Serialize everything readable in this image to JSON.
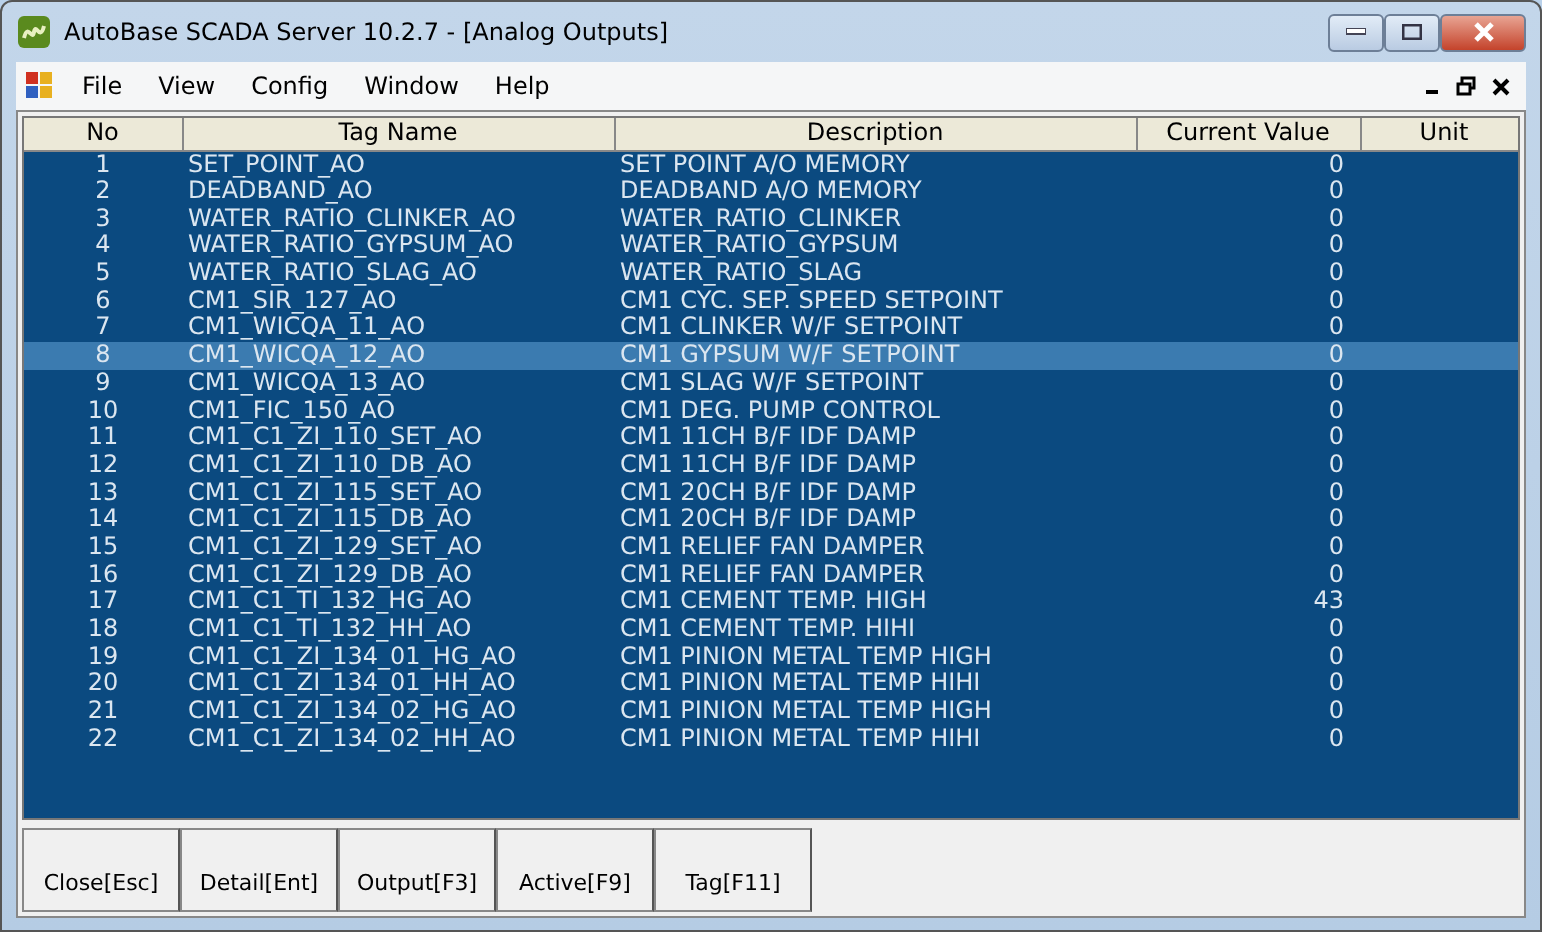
{
  "window": {
    "title": "AutoBase SCADA Server 10.2.7 - [Analog Outputs]"
  },
  "menu": [
    "File",
    "View",
    "Config",
    "Window",
    "Help"
  ],
  "table": {
    "columns": [
      "No",
      "Tag Name",
      "Description",
      "Current Value",
      "Unit"
    ],
    "rows": [
      {
        "cells": [
          "1",
          "SET_POINT_AO",
          "SET POINT A/O MEMORY",
          "0"
        ],
        "selected": false
      },
      {
        "cells": [
          "2",
          "DEADBAND_AO",
          "DEADBAND A/O MEMORY",
          "0"
        ],
        "selected": false
      },
      {
        "cells": [
          "3",
          "WATER_RATIO_CLINKER_AO",
          "WATER_RATIO_CLINKER",
          "0"
        ],
        "selected": false
      },
      {
        "cells": [
          "4",
          "WATER_RATIO_GYPSUM_AO",
          "WATER_RATIO_GYPSUM",
          "0"
        ],
        "selected": false
      },
      {
        "cells": [
          "5",
          "WATER_RATIO_SLAG_AO",
          "WATER_RATIO_SLAG",
          "0"
        ],
        "selected": false
      },
      {
        "cells": [
          "6",
          "CM1_SIR_127_AO",
          "CM1 CYC. SEP. SPEED SETPOINT",
          "0"
        ],
        "selected": false
      },
      {
        "cells": [
          "7",
          "CM1_WICQA_11_AO",
          "CM1 CLINKER W/F SETPOINT",
          "0"
        ],
        "selected": false
      },
      {
        "cells": [
          "8",
          "CM1_WICQA_12_AO",
          "CM1 GYPSUM W/F SETPOINT",
          "0"
        ],
        "selected": true
      },
      {
        "cells": [
          "9",
          "CM1_WICQA_13_AO",
          "CM1 SLAG W/F SETPOINT",
          "0"
        ],
        "selected": false
      },
      {
        "cells": [
          "10",
          "CM1_FIC_150_AO",
          "CM1 DEG. PUMP CONTROL",
          "0"
        ],
        "selected": false
      },
      {
        "cells": [
          "11",
          "CM1_C1_ZI_110_SET_AO",
          "CM1 11CH B/F IDF DAMP",
          "0"
        ],
        "selected": false
      },
      {
        "cells": [
          "12",
          "CM1_C1_ZI_110_DB_AO",
          "CM1 11CH B/F IDF DAMP",
          "0"
        ],
        "selected": false
      },
      {
        "cells": [
          "13",
          "CM1_C1_ZI_115_SET_AO",
          "CM1 20CH B/F IDF DAMP",
          "0"
        ],
        "selected": false
      },
      {
        "cells": [
          "14",
          "CM1_C1_ZI_115_DB_AO",
          "CM1 20CH B/F IDF DAMP",
          "0"
        ],
        "selected": false
      },
      {
        "cells": [
          "15",
          "CM1_C1_ZI_129_SET_AO",
          "CM1 RELIEF FAN DAMPER",
          "0"
        ],
        "selected": false
      },
      {
        "cells": [
          "16",
          "CM1_C1_ZI_129_DB_AO",
          "CM1 RELIEF FAN DAMPER",
          "0"
        ],
        "selected": false
      },
      {
        "cells": [
          "17",
          "CM1_C1_TI_132_HG_AO",
          "CM1 CEMENT TEMP. HIGH",
          "43"
        ],
        "selected": false
      },
      {
        "cells": [
          "18",
          "CM1_C1_TI_132_HH_AO",
          "CM1 CEMENT TEMP. HIHI",
          "0"
        ],
        "selected": false
      },
      {
        "cells": [
          "19",
          "CM1_C1_ZI_134_01_HG_AO",
          "CM1 PINION METAL TEMP HIGH",
          "0"
        ],
        "selected": false
      },
      {
        "cells": [
          "20",
          "CM1_C1_ZI_134_01_HH_AO",
          "CM1 PINION METAL TEMP HIHI",
          "0"
        ],
        "selected": false
      },
      {
        "cells": [
          "21",
          "CM1_C1_ZI_134_02_HG_AO",
          "CM1 PINION METAL TEMP HIGH",
          "0"
        ],
        "selected": false
      },
      {
        "cells": [
          "22",
          "CM1_C1_ZI_134_02_HH_AO",
          "CM1 PINION METAL TEMP HIHI",
          "0"
        ],
        "selected": false
      }
    ]
  },
  "buttons": [
    "Close[Esc]",
    "Detail[Ent]",
    "Output[F3]",
    "Active[F9]",
    "Tag[F11]"
  ]
}
